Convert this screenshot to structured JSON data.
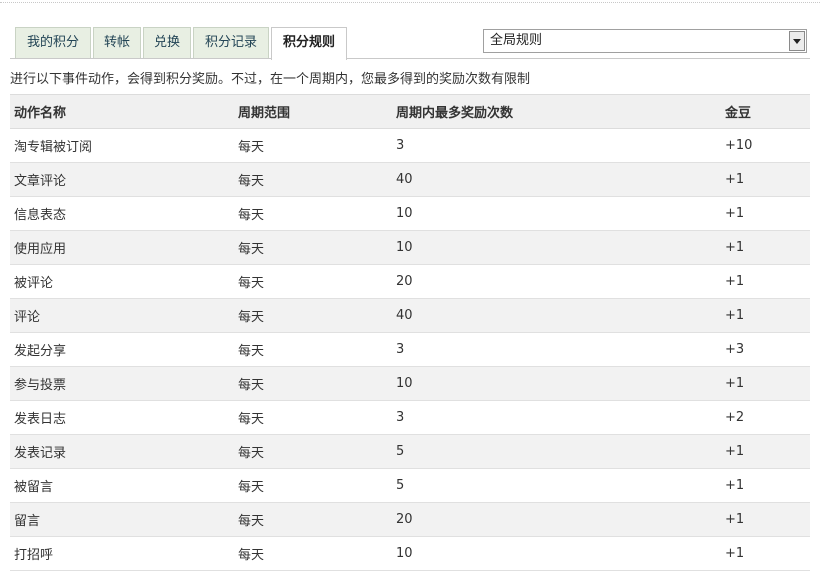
{
  "tabs": [
    {
      "label": "我的积分",
      "active": false
    },
    {
      "label": "转帐",
      "active": false
    },
    {
      "label": "兑换",
      "active": false
    },
    {
      "label": "积分记录",
      "active": false
    },
    {
      "label": "积分规则",
      "active": true
    }
  ],
  "scope_select": {
    "value": "全局规则"
  },
  "intro": "进行以下事件动作，会得到积分奖励。不过，在一个周期内，您最多得到的奖励次数有限制",
  "table": {
    "headers": [
      "动作名称",
      "周期范围",
      "周期内最多奖励次数",
      "金豆"
    ],
    "rows": [
      [
        "淘专辑被订阅",
        "每天",
        "3",
        "+10"
      ],
      [
        "文章评论",
        "每天",
        "40",
        "+1"
      ],
      [
        "信息表态",
        "每天",
        "10",
        "+1"
      ],
      [
        "使用应用",
        "每天",
        "10",
        "+1"
      ],
      [
        "被评论",
        "每天",
        "20",
        "+1"
      ],
      [
        "评论",
        "每天",
        "40",
        "+1"
      ],
      [
        "发起分享",
        "每天",
        "3",
        "+3"
      ],
      [
        "参与投票",
        "每天",
        "10",
        "+1"
      ],
      [
        "发表日志",
        "每天",
        "3",
        "+2"
      ],
      [
        "发表记录",
        "每天",
        "5",
        "+1"
      ],
      [
        "被留言",
        "每天",
        "5",
        "+1"
      ],
      [
        "留言",
        "每天",
        "20",
        "+1"
      ],
      [
        "打招呼",
        "每天",
        "10",
        "+1"
      ]
    ]
  }
}
